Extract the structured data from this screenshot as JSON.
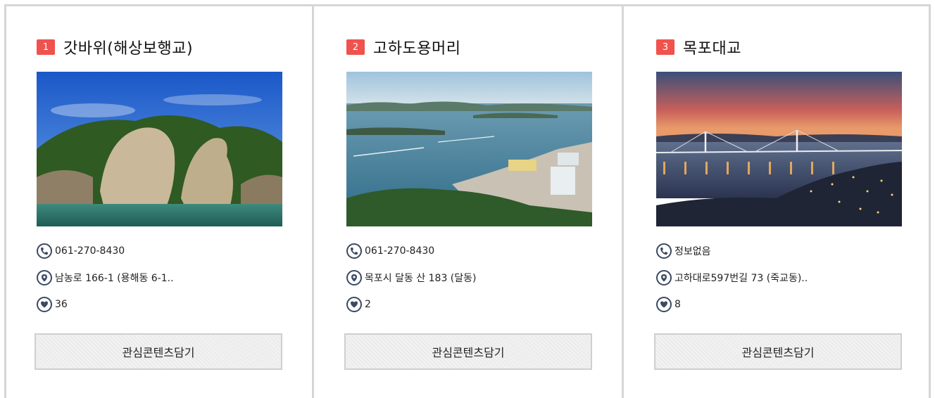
{
  "cards": [
    {
      "number": "1",
      "title": "갓바위(해상보행교)",
      "phone": "061-270-8430",
      "address": "남농로 166-1 (용해동 6-1..",
      "likes": "36",
      "button_label": "관심콘텐츠담기"
    },
    {
      "number": "2",
      "title": "고하도용머리",
      "phone": "061-270-8430",
      "address": "목포시 달동 산 183 (달동)",
      "likes": "2",
      "button_label": "관심콘텐츠담기"
    },
    {
      "number": "3",
      "title": "목포대교",
      "phone": "정보없음",
      "address": "고하대로597번길 73 (죽교동)..",
      "likes": "8",
      "button_label": "관심콘텐츠담기"
    }
  ],
  "colors": {
    "badge": "#f0524d",
    "icon_border": "#3b4a63",
    "divider": "#d6d6d6"
  },
  "icons": {
    "phone": "phone-icon",
    "location": "location-pin-icon",
    "likes": "heart-icon"
  }
}
